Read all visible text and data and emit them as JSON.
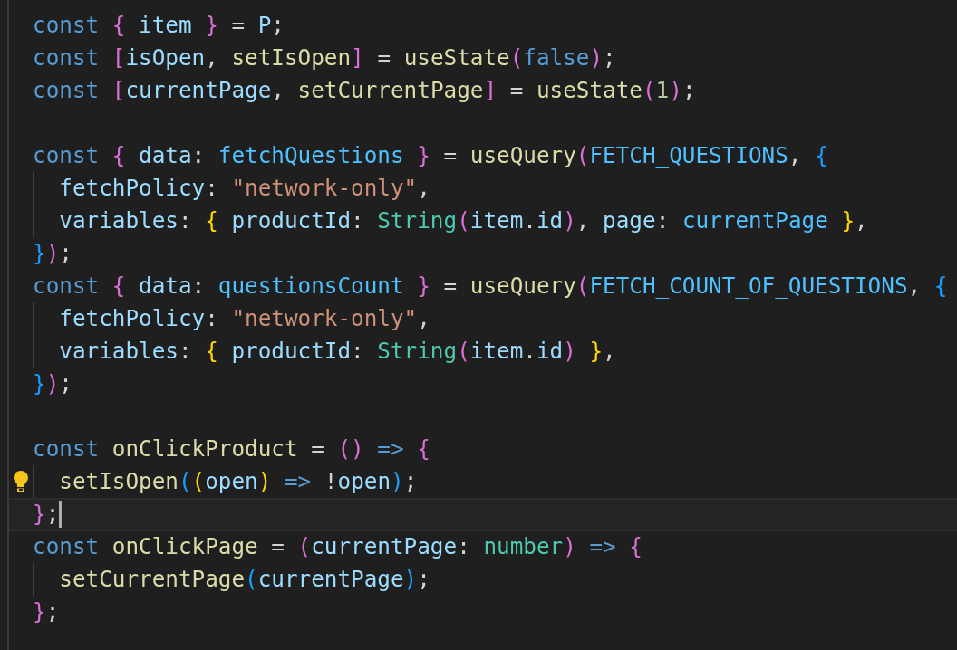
{
  "editor": {
    "lines": [
      {
        "kind": "code",
        "tokens": [
          {
            "text": "const",
            "kind": "keyword"
          },
          {
            "text": " {",
            "kind": "bracket2"
          },
          {
            "text": " item",
            "kind": "variable"
          },
          {
            "text": " }",
            "kind": "bracket2"
          },
          {
            "text": " =",
            "kind": "plain"
          },
          {
            "text": " P",
            "kind": "variable"
          },
          {
            "text": ";",
            "kind": "plain"
          }
        ]
      },
      {
        "kind": "code",
        "tokens": [
          {
            "text": "const",
            "kind": "keyword"
          },
          {
            "text": " [",
            "kind": "bracket2"
          },
          {
            "text": "isOpen",
            "kind": "variable"
          },
          {
            "text": ",",
            "kind": "plain"
          },
          {
            "text": " setIsOpen",
            "kind": "function"
          },
          {
            "text": "]",
            "kind": "bracket2"
          },
          {
            "text": " =",
            "kind": "plain"
          },
          {
            "text": " useState",
            "kind": "function"
          },
          {
            "text": "(",
            "kind": "bracket2"
          },
          {
            "text": "false",
            "kind": "keyword"
          },
          {
            "text": ")",
            "kind": "bracket2"
          },
          {
            "text": ";",
            "kind": "plain"
          }
        ]
      },
      {
        "kind": "code",
        "tokens": [
          {
            "text": "const",
            "kind": "keyword"
          },
          {
            "text": " [",
            "kind": "bracket2"
          },
          {
            "text": "currentPage",
            "kind": "variable"
          },
          {
            "text": ",",
            "kind": "plain"
          },
          {
            "text": " setCurrentPage",
            "kind": "function"
          },
          {
            "text": "]",
            "kind": "bracket2"
          },
          {
            "text": " =",
            "kind": "plain"
          },
          {
            "text": " useState",
            "kind": "function"
          },
          {
            "text": "(",
            "kind": "bracket2"
          },
          {
            "text": "1",
            "kind": "number"
          },
          {
            "text": ")",
            "kind": "bracket2"
          },
          {
            "text": ";",
            "kind": "plain"
          }
        ]
      },
      {
        "kind": "blank"
      },
      {
        "kind": "code",
        "tokens": [
          {
            "text": "const",
            "kind": "keyword"
          },
          {
            "text": " {",
            "kind": "bracket2"
          },
          {
            "text": " data",
            "kind": "variable"
          },
          {
            "text": ":",
            "kind": "plain"
          },
          {
            "text": " fetchQuestions",
            "kind": "constant"
          },
          {
            "text": " }",
            "kind": "bracket2"
          },
          {
            "text": " =",
            "kind": "plain"
          },
          {
            "text": " useQuery",
            "kind": "function"
          },
          {
            "text": "(",
            "kind": "bracket2"
          },
          {
            "text": "FETCH_QUESTIONS",
            "kind": "constant"
          },
          {
            "text": ",",
            "kind": "plain"
          },
          {
            "text": " {",
            "kind": "bracket3"
          }
        ]
      },
      {
        "kind": "code",
        "indented": true,
        "tokens": [
          {
            "text": "fetchPolicy",
            "kind": "variable"
          },
          {
            "text": ":",
            "kind": "plain"
          },
          {
            "text": " \"network-only\"",
            "kind": "string"
          },
          {
            "text": ",",
            "kind": "plain"
          }
        ]
      },
      {
        "kind": "code",
        "indented": true,
        "tokens": [
          {
            "text": "variables",
            "kind": "variable"
          },
          {
            "text": ":",
            "kind": "plain"
          },
          {
            "text": " {",
            "kind": "bracket1"
          },
          {
            "text": " productId",
            "kind": "variable"
          },
          {
            "text": ":",
            "kind": "plain"
          },
          {
            "text": " String",
            "kind": "type"
          },
          {
            "text": "(",
            "kind": "bracket2"
          },
          {
            "text": "item",
            "kind": "variable"
          },
          {
            "text": ".",
            "kind": "plain"
          },
          {
            "text": "id",
            "kind": "variable"
          },
          {
            "text": ")",
            "kind": "bracket2"
          },
          {
            "text": ",",
            "kind": "plain"
          },
          {
            "text": " page",
            "kind": "variable"
          },
          {
            "text": ":",
            "kind": "plain"
          },
          {
            "text": " currentPage",
            "kind": "constant"
          },
          {
            "text": " }",
            "kind": "bracket1"
          },
          {
            "text": ",",
            "kind": "plain"
          }
        ]
      },
      {
        "kind": "code",
        "tokens": [
          {
            "text": "}",
            "kind": "bracket3"
          },
          {
            "text": ")",
            "kind": "bracket2"
          },
          {
            "text": ";",
            "kind": "plain"
          }
        ]
      },
      {
        "kind": "code",
        "tokens": [
          {
            "text": "const",
            "kind": "keyword"
          },
          {
            "text": " {",
            "kind": "bracket2"
          },
          {
            "text": " data",
            "kind": "variable"
          },
          {
            "text": ":",
            "kind": "plain"
          },
          {
            "text": " questionsCount",
            "kind": "constant"
          },
          {
            "text": " }",
            "kind": "bracket2"
          },
          {
            "text": " =",
            "kind": "plain"
          },
          {
            "text": " useQuery",
            "kind": "function"
          },
          {
            "text": "(",
            "kind": "bracket2"
          },
          {
            "text": "FETCH_COUNT_OF_QUESTIONS",
            "kind": "constant"
          },
          {
            "text": ",",
            "kind": "plain"
          },
          {
            "text": " {",
            "kind": "bracket3"
          }
        ]
      },
      {
        "kind": "code",
        "indented": true,
        "tokens": [
          {
            "text": "fetchPolicy",
            "kind": "variable"
          },
          {
            "text": ":",
            "kind": "plain"
          },
          {
            "text": " \"network-only\"",
            "kind": "string"
          },
          {
            "text": ",",
            "kind": "plain"
          }
        ]
      },
      {
        "kind": "code",
        "indented": true,
        "tokens": [
          {
            "text": "variables",
            "kind": "variable"
          },
          {
            "text": ":",
            "kind": "plain"
          },
          {
            "text": " {",
            "kind": "bracket1"
          },
          {
            "text": " productId",
            "kind": "variable"
          },
          {
            "text": ":",
            "kind": "plain"
          },
          {
            "text": " String",
            "kind": "type"
          },
          {
            "text": "(",
            "kind": "bracket2"
          },
          {
            "text": "item",
            "kind": "variable"
          },
          {
            "text": ".",
            "kind": "plain"
          },
          {
            "text": "id",
            "kind": "variable"
          },
          {
            "text": ")",
            "kind": "bracket2"
          },
          {
            "text": " }",
            "kind": "bracket1"
          },
          {
            "text": ",",
            "kind": "plain"
          }
        ]
      },
      {
        "kind": "code",
        "tokens": [
          {
            "text": "}",
            "kind": "bracket3"
          },
          {
            "text": ")",
            "kind": "bracket2"
          },
          {
            "text": ";",
            "kind": "plain"
          }
        ]
      },
      {
        "kind": "blank"
      },
      {
        "kind": "code",
        "tokens": [
          {
            "text": "const",
            "kind": "keyword"
          },
          {
            "text": " onClickProduct",
            "kind": "function"
          },
          {
            "text": " =",
            "kind": "plain"
          },
          {
            "text": " ()",
            "kind": "bracket2"
          },
          {
            "text": " =>",
            "kind": "keyword"
          },
          {
            "text": " {",
            "kind": "bracket2"
          }
        ]
      },
      {
        "kind": "code",
        "indented": true,
        "lightbulb": true,
        "tokens": [
          {
            "text": "setIsOpen",
            "kind": "function"
          },
          {
            "text": "(",
            "kind": "bracket3"
          },
          {
            "text": "(",
            "kind": "bracket1"
          },
          {
            "text": "open",
            "kind": "variable"
          },
          {
            "text": ")",
            "kind": "bracket1"
          },
          {
            "text": " =>",
            "kind": "keyword"
          },
          {
            "text": " !",
            "kind": "plain"
          },
          {
            "text": "open",
            "kind": "variable"
          },
          {
            "text": ")",
            "kind": "bracket3"
          },
          {
            "text": ";",
            "kind": "plain"
          }
        ]
      },
      {
        "kind": "code",
        "current": true,
        "tokens": [
          {
            "text": "}",
            "kind": "bracket2"
          },
          {
            "text": ";",
            "kind": "plain"
          }
        ]
      },
      {
        "kind": "code",
        "tokens": [
          {
            "text": "const",
            "kind": "keyword"
          },
          {
            "text": " onClickPage",
            "kind": "function"
          },
          {
            "text": " =",
            "kind": "plain"
          },
          {
            "text": " (",
            "kind": "bracket2"
          },
          {
            "text": "currentPage",
            "kind": "variable"
          },
          {
            "text": ":",
            "kind": "plain"
          },
          {
            "text": " number",
            "kind": "type"
          },
          {
            "text": ")",
            "kind": "bracket2"
          },
          {
            "text": " =>",
            "kind": "keyword"
          },
          {
            "text": " {",
            "kind": "bracket2"
          }
        ]
      },
      {
        "kind": "code",
        "indented": true,
        "tokens": [
          {
            "text": "setCurrentPage",
            "kind": "function"
          },
          {
            "text": "(",
            "kind": "bracket3"
          },
          {
            "text": "currentPage",
            "kind": "variable"
          },
          {
            "text": ")",
            "kind": "bracket3"
          },
          {
            "text": ";",
            "kind": "plain"
          }
        ]
      },
      {
        "kind": "code",
        "tokens": [
          {
            "text": "}",
            "kind": "bracket2"
          },
          {
            "text": ";",
            "kind": "plain"
          }
        ]
      }
    ]
  }
}
